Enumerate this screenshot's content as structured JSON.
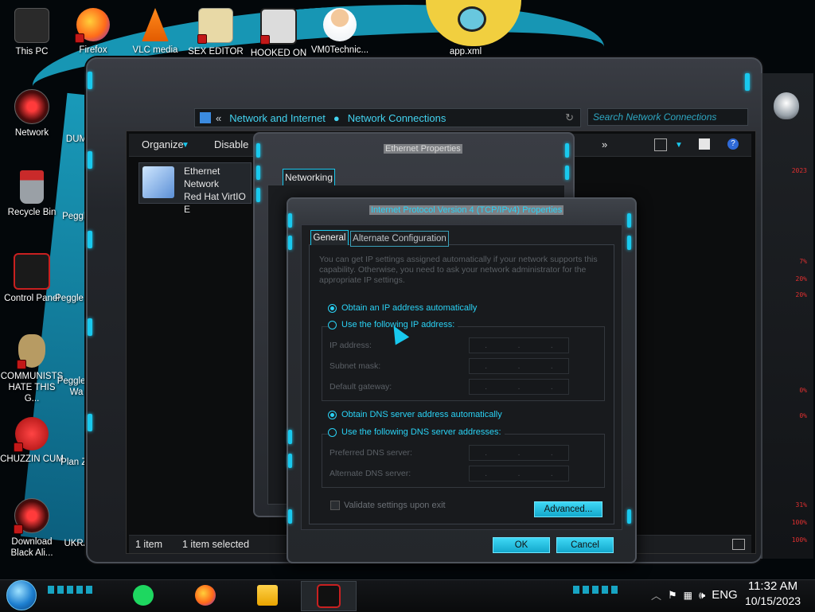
{
  "desktop": {
    "icons": [
      {
        "label": "This PC"
      },
      {
        "label": "Firefox"
      },
      {
        "label": "VLC media"
      },
      {
        "label": "SEX EDITOR"
      },
      {
        "label": "HOOKED ON"
      },
      {
        "label": "VM0Technic..."
      },
      {
        "label": "app.xml"
      },
      {
        "label": "Network"
      },
      {
        "label": "Recycle Bin"
      },
      {
        "label": "Control Panel"
      },
      {
        "label": "COMMUNISTS HATE THIS G..."
      },
      {
        "label": "CHUZZIN CUM"
      },
      {
        "label": "Download Black Ali..."
      },
      {
        "label": "DUM"
      },
      {
        "label": "Peggle"
      },
      {
        "label": "Peggle De"
      },
      {
        "label": "Peggle of Wa"
      },
      {
        "label": "Plan Zo"
      },
      {
        "label": "UKRAINE"
      }
    ]
  },
  "explorer": {
    "breadcrumb": [
      "Network and Internet",
      "Network Connections"
    ],
    "search_placeholder": "Search Network Connections",
    "commands": {
      "organize": "Organize",
      "disable": "Disable",
      "more": "»"
    },
    "item": {
      "name": "Ethernet",
      "status": "Network",
      "device": "Red Hat VirtIO E"
    },
    "status": {
      "count": "1 item",
      "selected": "1 item selected"
    }
  },
  "ethernet_properties": {
    "title": "Ethernet Properties",
    "tab": "Networking"
  },
  "ipv4": {
    "title": "Internet Protocol Version 4 (TCP/IPv4) Properties",
    "tabs": {
      "general": "General",
      "alternate": "Alternate Configuration"
    },
    "description": "You can get IP settings assigned automatically if your network supports this capability. Otherwise, you need to ask your network administrator for the appropriate IP settings.",
    "ip_auto": "Obtain an IP address automatically",
    "ip_manual": "Use the following IP address:",
    "ip_address_label": "IP address:",
    "subnet_label": "Subnet mask:",
    "gateway_label": "Default gateway:",
    "dns_auto": "Obtain DNS server address automatically",
    "dns_manual": "Use the following DNS server addresses:",
    "preferred_dns_label": "Preferred DNS server:",
    "alternate_dns_label": "Alternate DNS server:",
    "validate_label": "Validate settings upon exit",
    "advanced_label": "Advanced...",
    "ok_label": "OK",
    "cancel_label": "Cancel",
    "selected_ip_option": "auto",
    "selected_dns_option": "auto",
    "validate_checked": false
  },
  "side_panel": {
    "readouts": [
      "2023",
      "7%",
      "20%",
      "20%",
      "0%",
      "0%",
      "31%",
      "100%",
      "100%"
    ]
  },
  "taskbar": {
    "apps": [
      "spotify-icon",
      "firefox-icon",
      "file-explorer-icon",
      "alienware-app-icon"
    ],
    "language": "ENG",
    "time": "11:32 AM",
    "date": "10/15/2023"
  },
  "colors": {
    "accent": "#19c9ee",
    "frame": "#2a2d32"
  }
}
